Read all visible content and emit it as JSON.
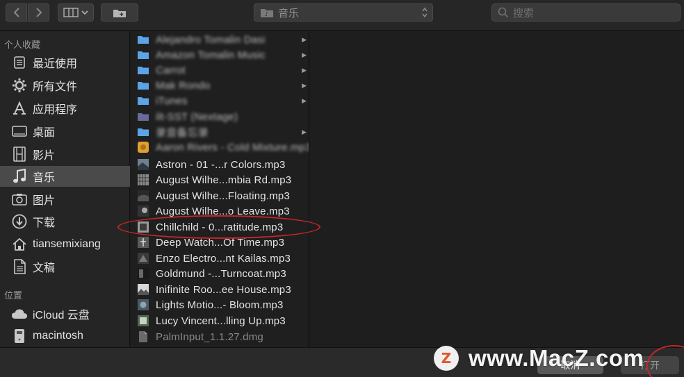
{
  "toolbar": {
    "location": "音乐",
    "search_placeholder": "搜索"
  },
  "sidebar": {
    "favorites_title": "个人收藏",
    "favorites": [
      {
        "label": "最近使用",
        "icon": "recents-icon"
      },
      {
        "label": "所有文件",
        "icon": "all-files-icon"
      },
      {
        "label": "应用程序",
        "icon": "applications-icon"
      },
      {
        "label": "桌面",
        "icon": "desktop-icon"
      },
      {
        "label": "影片",
        "icon": "movies-icon"
      },
      {
        "label": "音乐",
        "icon": "music-icon",
        "selected": true
      },
      {
        "label": "图片",
        "icon": "pictures-icon"
      },
      {
        "label": "下载",
        "icon": "downloads-icon"
      },
      {
        "label": "tiansemixiang",
        "icon": "home-icon"
      },
      {
        "label": "文稿",
        "icon": "documents-icon"
      }
    ],
    "locations_title": "位置",
    "locations": [
      {
        "label": "iCloud 云盘",
        "icon": "icloud-icon"
      },
      {
        "label": "macintosh",
        "icon": "disk-icon"
      }
    ]
  },
  "files": [
    {
      "name": "Alejandro Tomalin Dasi",
      "kind": "folder",
      "blurred": true
    },
    {
      "name": "Amazon Tomalin Music",
      "kind": "folder",
      "blurred": true
    },
    {
      "name": "Carrot",
      "kind": "folder",
      "blurred": true
    },
    {
      "name": "Mak Rondo",
      "kind": "folder",
      "blurred": true
    },
    {
      "name": "iTunes",
      "kind": "folder",
      "blurred": true
    },
    {
      "name": "ilt-SST (Nextage)",
      "kind": "folder-alias",
      "blurred": true
    },
    {
      "name": "录音备忘录",
      "kind": "folder",
      "blurred": true
    },
    {
      "name": "Aaron Rivers - Cold Mixture.mp3",
      "kind": "audio-art-orange",
      "blurred": true
    },
    {
      "name": "Astron - 01 -...r Colors.mp3",
      "kind": "audio"
    },
    {
      "name": "August Wilhe...mbia Rd.mp3",
      "kind": "audio"
    },
    {
      "name": "August Wilhe...Floating.mp3",
      "kind": "audio"
    },
    {
      "name": "August Wilhe...o Leave.mp3",
      "kind": "audio"
    },
    {
      "name": "Chillchild - 0...ratitude.mp3",
      "kind": "audio"
    },
    {
      "name": "Deep Watch...Of Time.mp3",
      "kind": "audio"
    },
    {
      "name": "Enzo Electro...nt Kailas.mp3",
      "kind": "audio"
    },
    {
      "name": "Goldmund -...Turncoat.mp3",
      "kind": "audio"
    },
    {
      "name": "Inifinite Roo...ee House.mp3",
      "kind": "audio"
    },
    {
      "name": "Lights Motio...- Bloom.mp3",
      "kind": "audio"
    },
    {
      "name": "Lucy Vincent...lling Up.mp3",
      "kind": "audio"
    },
    {
      "name": "PalmInput_1.1.27.dmg",
      "kind": "dmg",
      "dim": true
    }
  ],
  "buttons": {
    "cancel": "取消",
    "open": "打开"
  },
  "watermark": {
    "logo_letter": "Z",
    "text": "www.MacZ.com"
  },
  "colors": {
    "highlight_ring": "#c4262a",
    "folder_blue": "#5ba5e6",
    "selection": "#4a4a4a"
  }
}
